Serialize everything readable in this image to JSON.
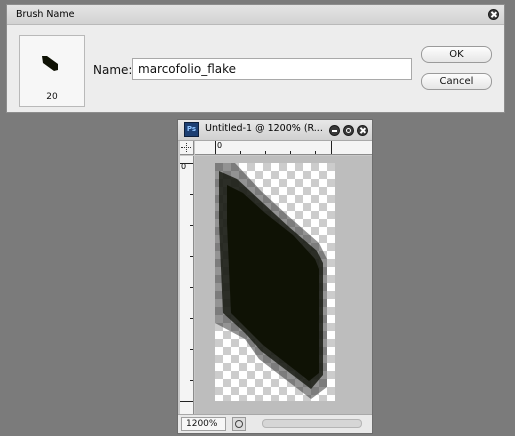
{
  "dialog": {
    "title": "Brush Name",
    "brush_size": "20",
    "name_label": "Name:",
    "name_value": "marcofolio_flake",
    "ok_label": "OK",
    "cancel_label": "Cancel"
  },
  "document": {
    "title": "Untitled-1 @ 1200% (R...",
    "app_icon": "Ps",
    "ruler_h_label": "0",
    "ruler_v_label": "0",
    "zoom": "1200%"
  },
  "colors": {
    "background": "#7b7b7b",
    "brush_fill": "#0f1205"
  },
  "icons": {
    "dialog_close": "close-icon",
    "doc_minimize": "minimize-icon",
    "doc_maximize": "maximize-icon",
    "doc_close": "close-icon",
    "status_menu": "status-menu-icon"
  }
}
